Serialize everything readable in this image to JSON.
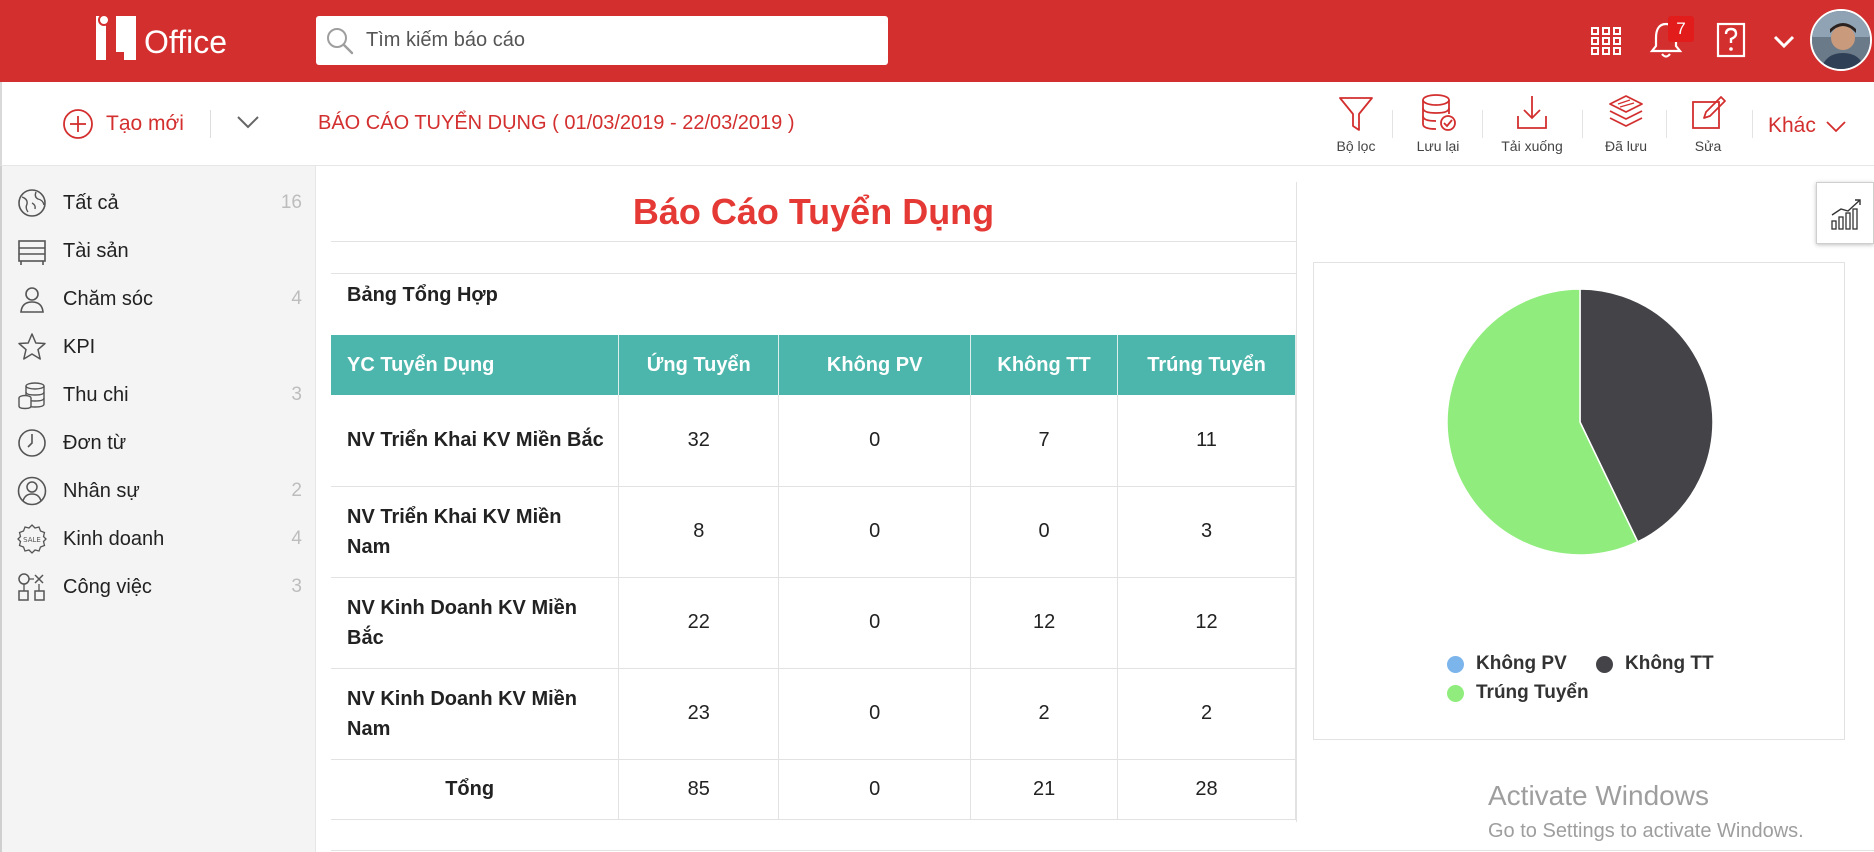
{
  "header": {
    "logo_text": "Office",
    "search_placeholder": "Tìm kiếm báo cáo",
    "notification_count": "7",
    "colors": {
      "brand": "#d32f2f",
      "badge": "#e21b1b"
    },
    "icons": [
      "search-icon",
      "apps-grid-icon",
      "bell-icon",
      "help-icon",
      "chevron-down-icon",
      "avatar"
    ]
  },
  "toolbar": {
    "create_label": "Tạo mới",
    "report_title": "BÁO CÁO TUYỂN DỤNG ( 01/03/2019 - 22/03/2019 )",
    "tools": {
      "filter": "Bộ lọc",
      "save": "Lưu lại",
      "download": "Tải xuống",
      "saved": "Đã lưu",
      "edit": "Sửa"
    },
    "more_label": "Khác"
  },
  "sidebar": {
    "items": [
      {
        "label": "Tất cả",
        "count": "16",
        "icon": "globe-icon"
      },
      {
        "label": "Tài sản",
        "count": "",
        "icon": "drawer-icon"
      },
      {
        "label": "Chăm sóc",
        "count": "4",
        "icon": "person-icon"
      },
      {
        "label": "KPI",
        "count": "",
        "icon": "star-icon"
      },
      {
        "label": "Thu chi",
        "count": "3",
        "icon": "coins-icon"
      },
      {
        "label": "Đơn từ",
        "count": "",
        "icon": "clock-icon"
      },
      {
        "label": "Nhân sự",
        "count": "2",
        "icon": "user-circle-icon"
      },
      {
        "label": "Kinh doanh",
        "count": "4",
        "icon": "sale-badge-icon"
      },
      {
        "label": "Công việc",
        "count": "3",
        "icon": "workflow-icon"
      }
    ]
  },
  "report": {
    "heading": "Báo Cáo Tuyển Dụng",
    "summary_title": "Bảng Tổng Hợp",
    "columns": [
      "YC Tuyển Dụng",
      "Ứng Tuyển",
      "Không PV",
      "Không TT",
      "Trúng Tuyển"
    ],
    "rows": [
      {
        "name": "NV Triển Khai KV Miền Bắc",
        "applied": "32",
        "no_interview": "0",
        "not_passed": "7",
        "hired": "11"
      },
      {
        "name": "NV Triển Khai KV Miền Nam",
        "applied": "8",
        "no_interview": "0",
        "not_passed": "0",
        "hired": "3"
      },
      {
        "name": "NV Kinh Doanh KV Miền Bắc",
        "applied": "22",
        "no_interview": "0",
        "not_passed": "12",
        "hired": "12"
      },
      {
        "name": "NV Kinh Doanh KV Miền Nam",
        "applied": "23",
        "no_interview": "0",
        "not_passed": "2",
        "hired": "2"
      }
    ],
    "total": {
      "name": "Tổng",
      "applied": "85",
      "no_interview": "0",
      "not_passed": "21",
      "hired": "28"
    },
    "colors": {
      "header": "#4db6ac",
      "heading": "#e53935"
    }
  },
  "chart_data": {
    "type": "pie",
    "labels": [
      "Không PV",
      "Không TT",
      "Trúng Tuyển"
    ],
    "values": [
      0,
      21,
      28
    ],
    "colors": [
      "#7cb5ec",
      "#434348",
      "#90ed7d"
    ],
    "title": "",
    "legend": "bottom"
  },
  "watermark": {
    "title": "Activate Windows",
    "subtitle": "Go to Settings to activate Windows."
  }
}
